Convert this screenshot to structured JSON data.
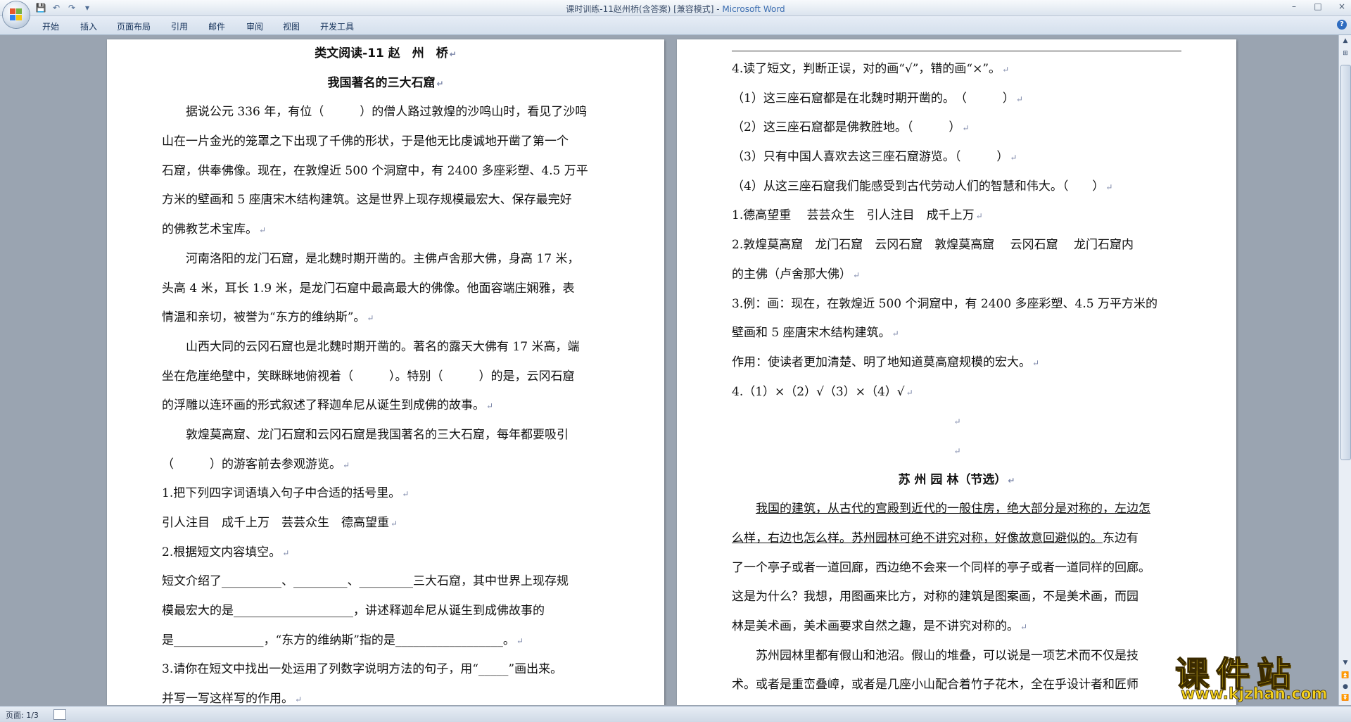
{
  "window": {
    "title_doc": "课时训练-11赵州桥(含答案) [兼容模式] - ",
    "title_app": "Microsoft Word",
    "win_controls": [
      "–",
      "□",
      "×"
    ],
    "qat_icons": [
      "save-icon",
      "undo-icon",
      "redo-icon",
      "customize-icon"
    ]
  },
  "ribbon": {
    "tabs": [
      "开始",
      "插入",
      "页面布局",
      "引用",
      "邮件",
      "审阅",
      "视图",
      "开发工具"
    ]
  },
  "status": {
    "page": "页面: 1/3"
  },
  "left_page": {
    "title": "类文阅读-11 赵　州　桥",
    "subtitle": "我国著名的三大石窟",
    "lines": [
      "据说公元 336 年，有位（　　　）的僧人路过敦煌的沙鸣山时，看见了沙鸣",
      "山在一片金光的笼罩之下出现了千佛的形状，于是他无比虔诚地开凿了第一个",
      "石窟，供奉佛像。现在，在敦煌近 500 个洞窟中，有 2400 多座彩塑、4.5 万平",
      "方米的壁画和 5 座唐宋木结构建筑。这是世界上现存规模最宏大、保存最完好",
      "的佛教艺术宝库。",
      "河南洛阳的龙门石窟，是北魏时期开凿的。主佛卢舍那大佛，身高 17 米，",
      "头高 4 米，耳长 1.9 米，是龙门石窟中最高最大的佛像。他面容端庄娴雅，表",
      "情温和亲切，被誉为“东方的维纳斯”。",
      "山西大同的云冈石窟也是北魏时期开凿的。著名的露天大佛有 17 米高，端",
      "坐在危崖绝壁中，笑眯眯地俯视着（　　　）。特别（　　　）的是，云冈石窟",
      "的浮雕以连环画的形式叙述了释迦牟尼从诞生到成佛的故事。",
      "敦煌莫高窟、龙门石窟和云冈石窟是我国著名的三大石窟，每年都要吸引",
      "（　　　）的游客前去参观游览。",
      "1.把下列四字词语填入句子中合适的括号里。",
      "引人注目　成千上万　芸芸众生　德高望重",
      "2.根据短文内容填空。",
      "短文介绍了__________、_________、_________三大石窟，其中世界上现存规",
      "模最宏大的是____________________，讲述释迦牟尼从诞生到成佛故事的",
      "是_______________，“东方的维纳斯”指的是__________________。",
      "3.请你在短文中找出一处运用了列数字说明方法的句子，用“_____”画出来。",
      "并写一写这样写的作用。"
    ]
  },
  "right_page": {
    "lines_top": [
      "4.读了短文，判断正误，对的画“√”，错的画“×”。",
      "（1）这三座石窟都是在北魏时期开凿的。　（　　　）",
      "（2）这三座石窟都是佛教胜地。（　　　）",
      "（3）只有中国人喜欢去这三座石窟游览。（　　　）",
      "（4）从这三座石窟我们能感受到古代劳动人们的智慧和伟大。（　　）",
      "1.德高望重　 芸芸众生　引人注目　成千上万",
      "2.敦煌莫高窟　龙门石窟　云冈石窟　敦煌莫高窟　 云冈石窟　 龙门石窟内",
      "的主佛（卢舍那大佛）",
      "3.例：画：现在，在敦煌近 500 个洞窟中，有 2400 多座彩塑、4.5 万平方米的",
      "壁画和 5 座唐宋木结构建筑。",
      "作用：使读者更加清楚、明了地知道莫高窟规模的宏大。",
      "4.（1）×（2）√（3）×（4）√"
    ],
    "title2": "苏 州 园 林（节选）",
    "para_underlined_1": "我国的建筑，从古代的宫殿到近代的一般住房，绝大部分是对称的，左边怎",
    "para_underlined_2": "么样，右边也怎么样。苏州园林可绝不讲究对称，好像故意回避似的。",
    "para_rest_2": "东边有",
    "lines_bottom": [
      "了一个亭子或者一道回廊，西边绝不会来一个同样的亭子或者一道同样的回廊。",
      "这是为什么？我想，用图画来比方，对称的建筑是图案画，不是美术画，而园",
      "林是美术画，美术画要求自然之趣，是不讲究对称的。",
      "苏州园林里都有假山和池沼。假山的堆叠，可以说是一项艺术而不仅是技",
      "术。或者是重峦叠嶂，或者是几座小山配合着竹子花木，全在乎设计者和匠师"
    ]
  },
  "watermark": {
    "cn": "课件站",
    "url": "www.kjzhan.com"
  }
}
